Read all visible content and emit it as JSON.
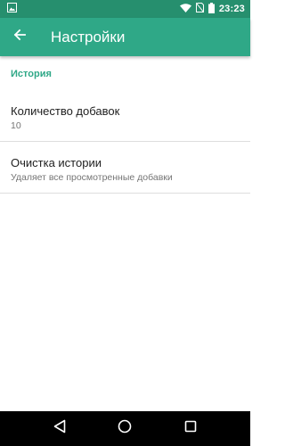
{
  "status_bar": {
    "time": "23:23",
    "icons": [
      "image-notification-icon",
      "wifi-icon",
      "no-sim-icon",
      "battery-icon"
    ]
  },
  "app_bar": {
    "title": "Настройки",
    "back_icon": "arrow-back-icon"
  },
  "colors": {
    "status_bar": "#268f6e",
    "app_bar": "#2fa887",
    "accent": "#2fa887"
  },
  "settings": {
    "category": "История",
    "items": [
      {
        "title": "Количество добавок",
        "summary": "10"
      },
      {
        "title": "Очистка истории",
        "summary": "Удаляет все просмотренные добавки"
      }
    ]
  },
  "nav_bar": {
    "icons": [
      "back-triangle-icon",
      "home-circle-icon",
      "recents-square-icon"
    ]
  }
}
